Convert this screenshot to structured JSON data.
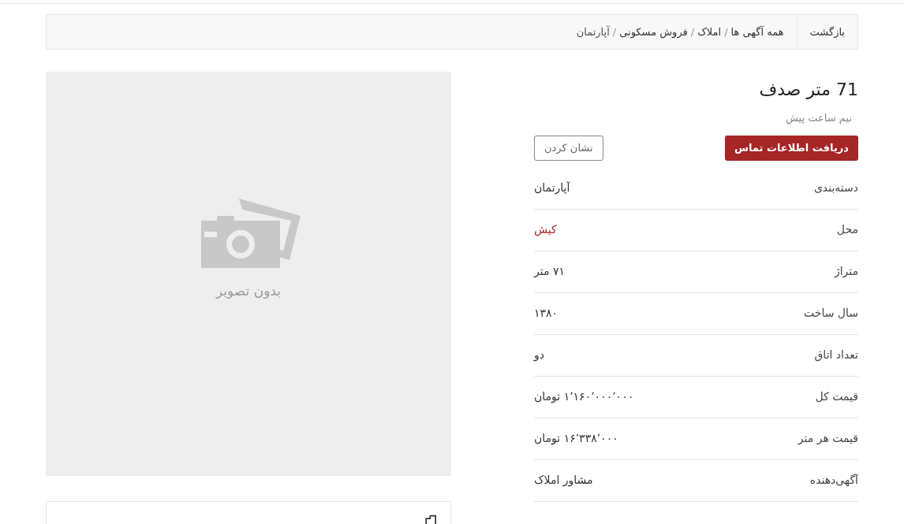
{
  "breadcrumb": {
    "back": "بازگشت",
    "separator": "/",
    "items": [
      {
        "label": "همه آگهی ها",
        "kind": "link"
      },
      {
        "label": "املاک",
        "kind": "link"
      },
      {
        "label": "فروش مسکونی",
        "kind": "link"
      },
      {
        "label": "آپارتمان",
        "kind": "current"
      }
    ]
  },
  "listing": {
    "title": "71 متر صدف",
    "time": "نیم ساعت پیش",
    "contact_button": "دریافت اطلاعات تماس",
    "bookmark_button": "نشان کردن",
    "details": [
      {
        "label": "دسته‌بندی",
        "value": "آپارتمان",
        "kind": "text"
      },
      {
        "label": "محل",
        "value": "کیش",
        "kind": "link"
      },
      {
        "label": "متراژ",
        "value": "۷۱ متر",
        "kind": "text"
      },
      {
        "label": "سال ساخت",
        "value": "۱۳۸۰",
        "kind": "text"
      },
      {
        "label": "تعداد اتاق",
        "value": "دو",
        "kind": "text"
      },
      {
        "label": "قیمت کل",
        "value": "۱٬۱۶۰٬۰۰۰٬۰۰۰ تومان",
        "kind": "text"
      },
      {
        "label": "قیمت هر متر",
        "value": "۱۶٬۳۳۸٬۰۰۰ تومان",
        "kind": "text"
      },
      {
        "label": "آگهی‌دهنده",
        "value": "مشاور املاک",
        "kind": "text"
      }
    ]
  },
  "image": {
    "placeholder": "بدون تصویر"
  }
}
